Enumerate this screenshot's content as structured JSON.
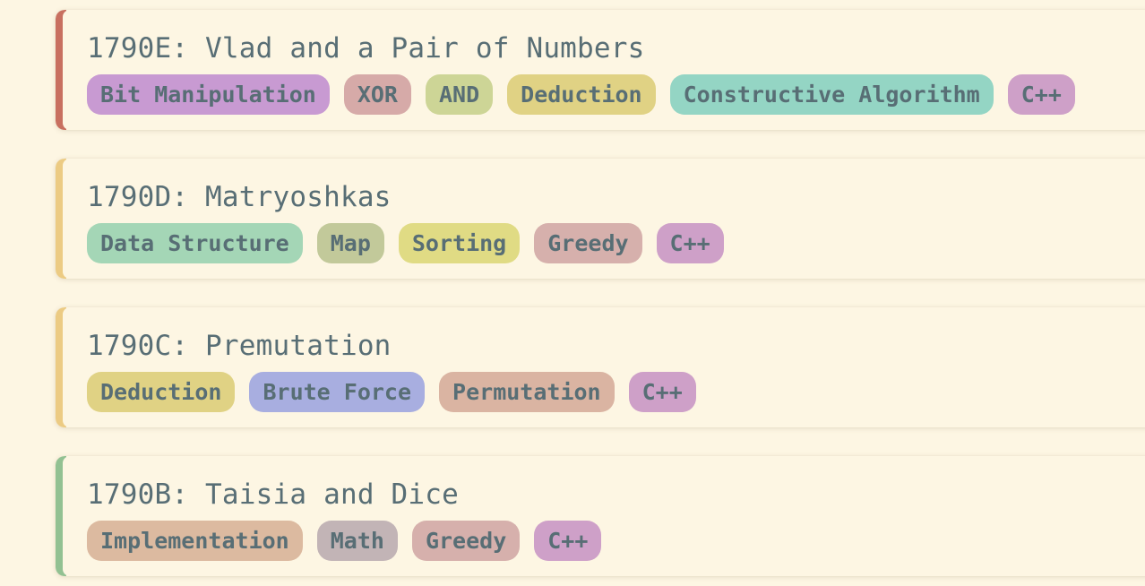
{
  "problems": [
    {
      "title": "1790E: Vlad and a Pair of Numbers",
      "accent": "#c87060",
      "tags": [
        {
          "label": "Bit Manipulation",
          "color": "#c89ad2"
        },
        {
          "label": "XOR",
          "color": "#d6aaa8"
        },
        {
          "label": "AND",
          "color": "#cdd596"
        },
        {
          "label": "Deduction",
          "color": "#e0d284"
        },
        {
          "label": "Constructive Algorithm",
          "color": "#94d5c4"
        },
        {
          "label": "C++",
          "color": "#cea0c8"
        }
      ]
    },
    {
      "title": "1790D: Matryoshkas",
      "accent": "#eccb83",
      "tags": [
        {
          "label": "Data Structure",
          "color": "#a4d6b6"
        },
        {
          "label": "Map",
          "color": "#c2c99a"
        },
        {
          "label": "Sorting",
          "color": "#e0db84"
        },
        {
          "label": "Greedy",
          "color": "#d6b0ac"
        },
        {
          "label": "C++",
          "color": "#cea0c8"
        }
      ]
    },
    {
      "title": "1790C: Premutation",
      "accent": "#eccb83",
      "tags": [
        {
          "label": "Deduction",
          "color": "#e0d284"
        },
        {
          "label": "Brute Force",
          "color": "#a8aee0"
        },
        {
          "label": "Permutation",
          "color": "#dab4a2"
        },
        {
          "label": "C++",
          "color": "#cea0c8"
        }
      ]
    },
    {
      "title": "1790B: Taisia and Dice",
      "accent": "#92c192",
      "tags": [
        {
          "label": "Implementation",
          "color": "#dcbaa0"
        },
        {
          "label": "Math",
          "color": "#c2b4b6"
        },
        {
          "label": "Greedy",
          "color": "#d6b0ac"
        },
        {
          "label": "C++",
          "color": "#cea0c8"
        }
      ]
    }
  ]
}
